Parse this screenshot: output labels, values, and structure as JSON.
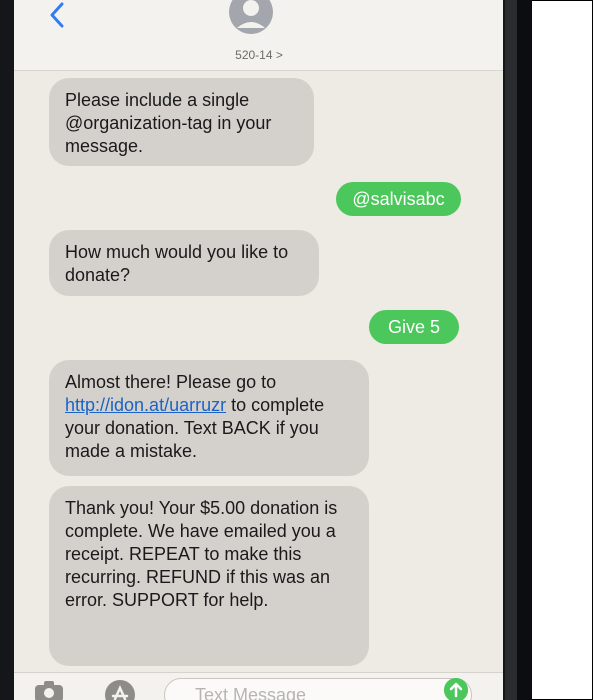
{
  "header": {
    "contact": "520-14 >",
    "back_icon": "chevron-left-icon",
    "avatar_icon": "person-icon"
  },
  "messages": [
    {
      "type": "received",
      "text": "Please include a single @organization-tag in your message."
    },
    {
      "type": "sent",
      "text": "@salvisabc"
    },
    {
      "type": "received",
      "text": "How much would you like to donate?"
    },
    {
      "type": "sent",
      "text": "Give 5"
    },
    {
      "type": "received",
      "text_before": "Almost there! Please go to ",
      "link": "http://idon.at/uarruzr",
      "text_after": " to complete your donation. Text BACK if you made a mistake."
    },
    {
      "type": "received",
      "text": "Thank you! Your $5.00 donation is complete. We have emailed you a receipt. REPEAT to make this recurring. REFUND if this was an error. SUPPORT for help."
    }
  ],
  "input": {
    "placeholder": "Text Message",
    "camera_icon": "camera-icon",
    "apps_icon": "app-store-icon",
    "send_icon": "send-arrow-icon"
  },
  "colors": {
    "sent_bubble": "#4cc75b",
    "received_bubble": "#d4d1cd",
    "link": "#1b63c6"
  }
}
